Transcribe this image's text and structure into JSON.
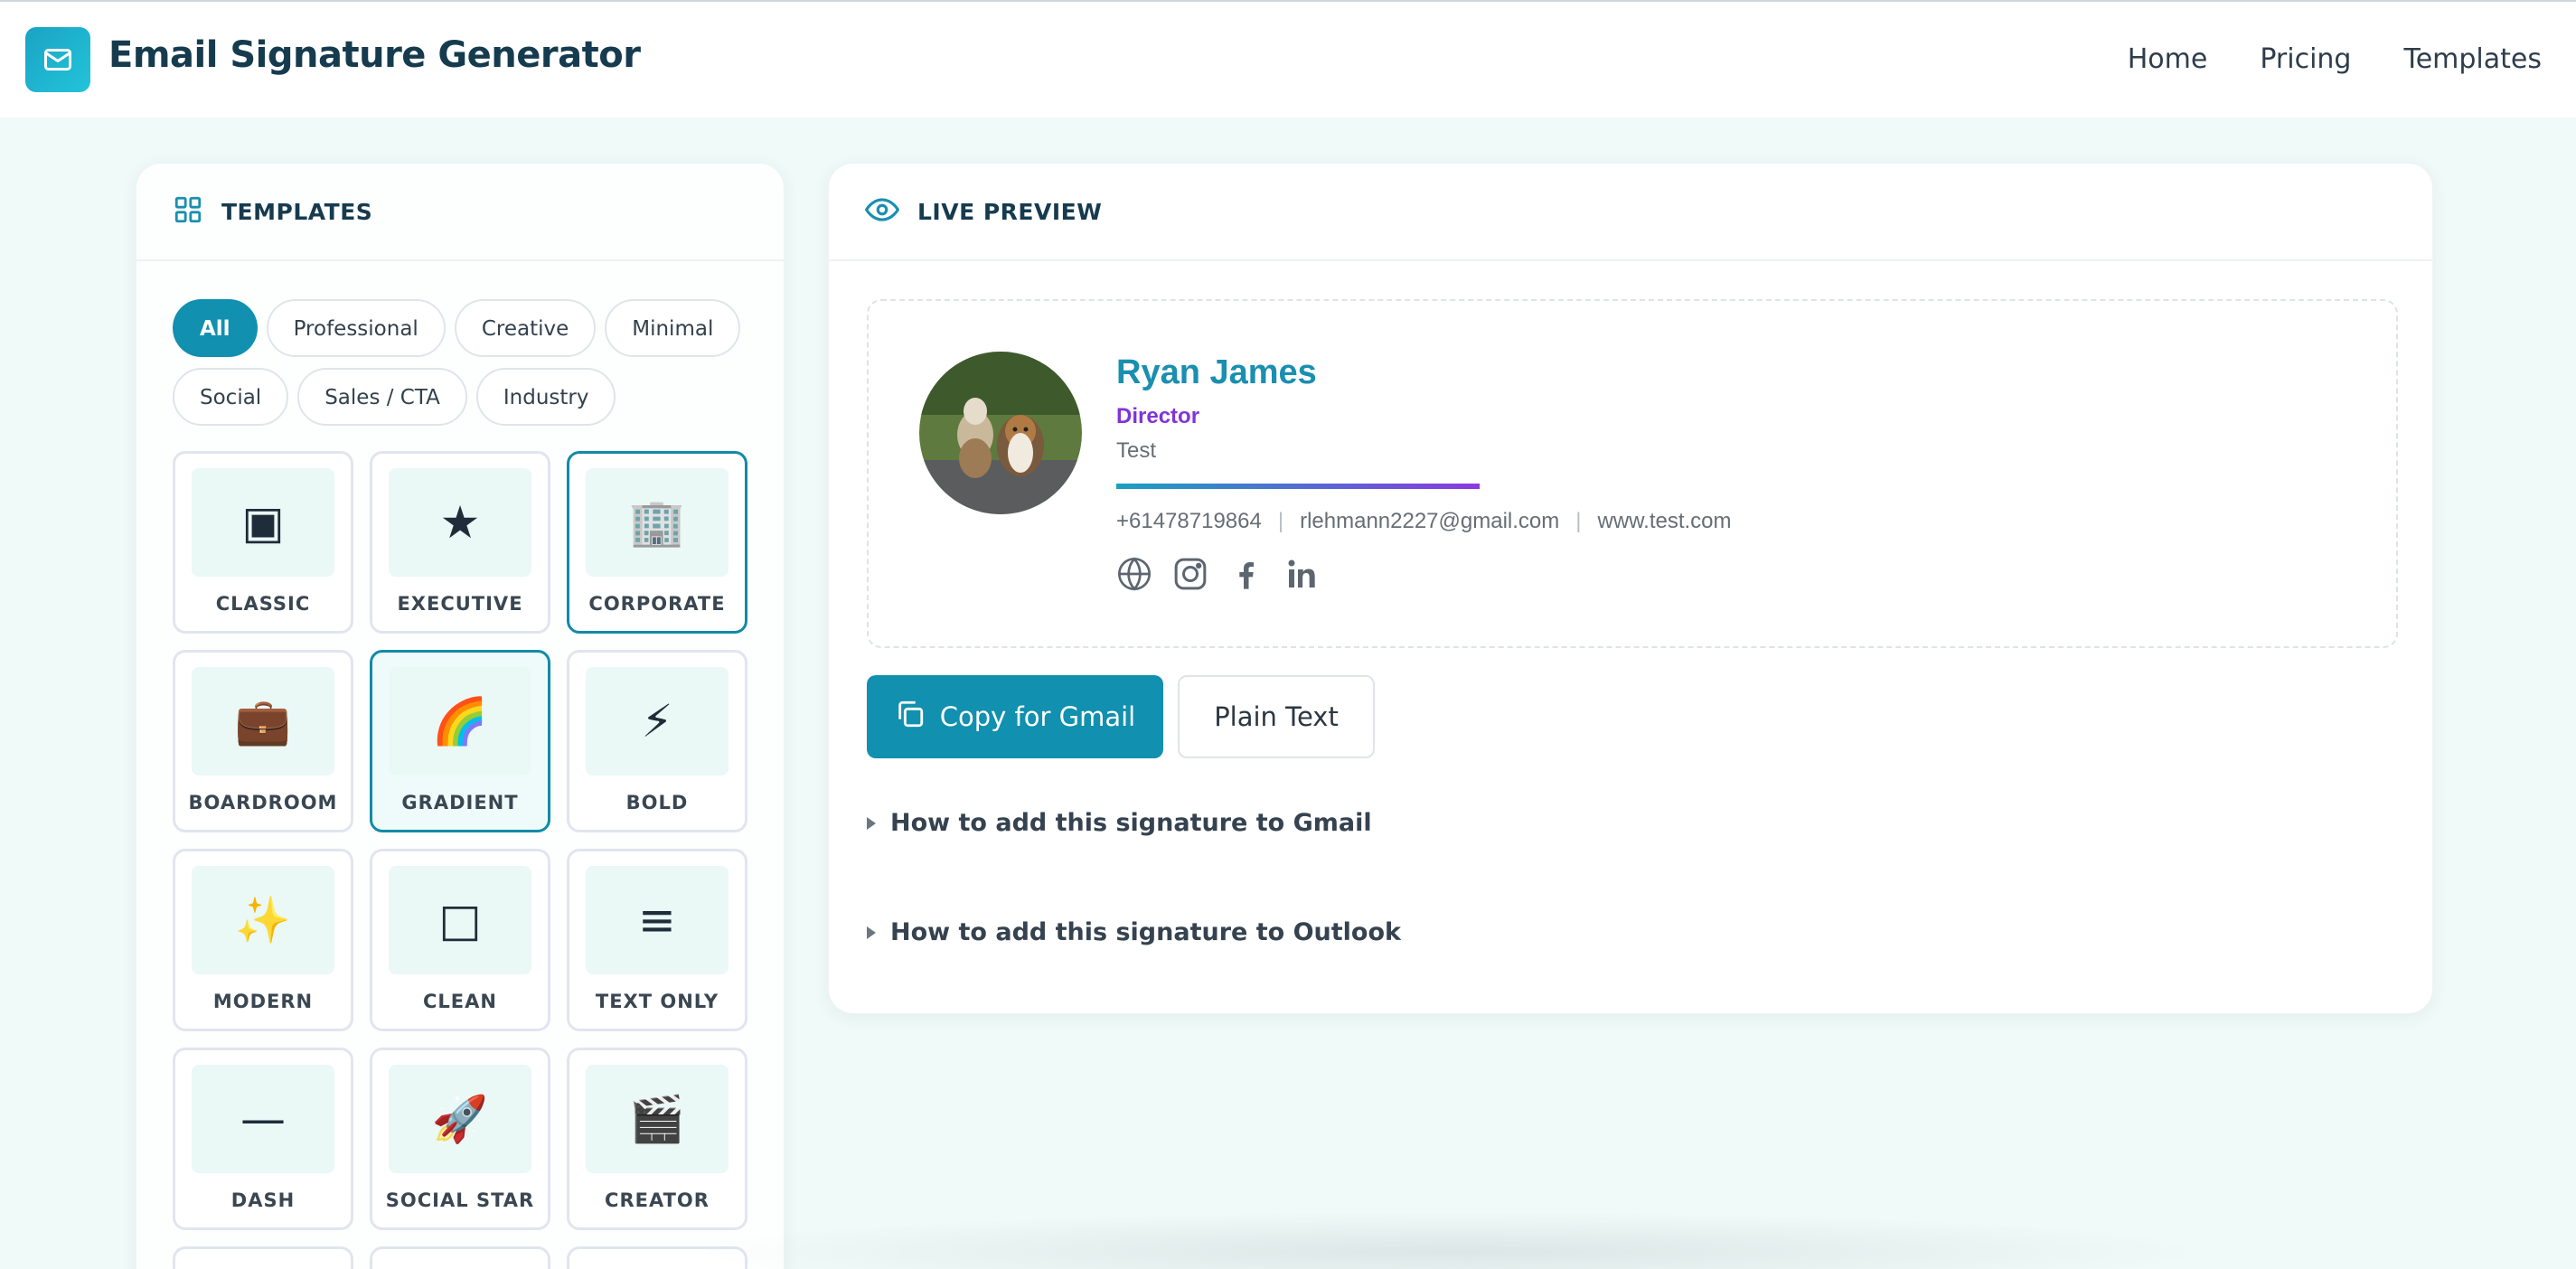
{
  "header": {
    "app_title": "Email Signature Generator",
    "logo_icon": "mail-icon",
    "nav": [
      "Home",
      "Pricing",
      "Templates"
    ]
  },
  "templates_panel": {
    "title": "TEMPLATES",
    "filters": [
      "All",
      "Professional",
      "Creative",
      "Minimal",
      "Social",
      "Sales / CTA",
      "Industry"
    ],
    "active_filter": "All",
    "cards": [
      {
        "label": "CLASSIC",
        "icon": "▣"
      },
      {
        "label": "EXECUTIVE",
        "icon": "★"
      },
      {
        "label": "CORPORATE",
        "icon": "🏢"
      },
      {
        "label": "BOARDROOM",
        "icon": "💼"
      },
      {
        "label": "GRADIENT",
        "icon": "🌈"
      },
      {
        "label": "BOLD",
        "icon": "⚡"
      },
      {
        "label": "MODERN",
        "icon": "✨"
      },
      {
        "label": "CLEAN",
        "icon": "□"
      },
      {
        "label": "TEXT ONLY",
        "icon": "≡"
      },
      {
        "label": "DASH",
        "icon": "—"
      },
      {
        "label": "SOCIAL STAR",
        "icon": "🚀"
      },
      {
        "label": "CREATOR",
        "icon": "🎬"
      }
    ]
  },
  "preview_panel": {
    "title": "LIVE PREVIEW",
    "signature": {
      "name": "Ryan James",
      "role": "Director",
      "company": "Test",
      "phone": "+61478719864",
      "email": "rlehmann2227@gmail.com",
      "website": "www.test.com",
      "name_color": "#1a8fb0",
      "role_color": "#8034d8",
      "socials": [
        "globe-icon",
        "instagram-icon",
        "facebook-icon",
        "linkedin-icon"
      ]
    },
    "copy_button": "Copy for Gmail",
    "plain_text_button": "Plain Text",
    "faq": [
      "How to add this signature to Gmail",
      "How to add this signature to Outlook"
    ]
  }
}
